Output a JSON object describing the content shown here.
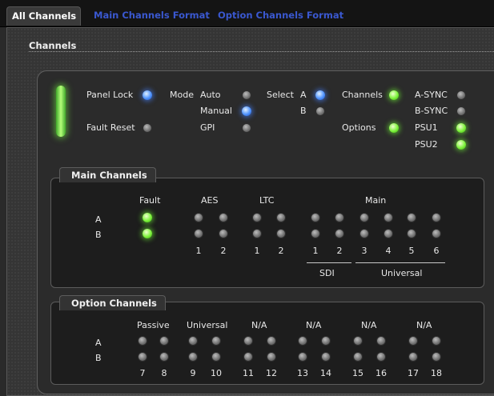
{
  "tabs": {
    "all_channels": "All Channels",
    "main_channels_format": "Main Channels Format",
    "option_channels_format": "Option Channels Format"
  },
  "section_title": "Channels",
  "status": {
    "panel_lock": "Panel Lock",
    "fault_reset": "Fault Reset",
    "mode": "Mode",
    "mode_auto": "Auto",
    "mode_manual": "Manual",
    "mode_gpi": "GPI",
    "select": "Select",
    "select_a": "A",
    "select_b": "B",
    "channels": "Channels",
    "options": "Options",
    "a_sync": "A-SYNC",
    "b_sync": "B-SYNC",
    "psu1": "PSU1",
    "psu2": "PSU2"
  },
  "main_channels": {
    "title": "Main Channels",
    "row_a": "A",
    "row_b": "B",
    "fault": "Fault",
    "aes": "AES",
    "ltc": "LTC",
    "main": "Main",
    "aes_nums": [
      "1",
      "2"
    ],
    "ltc_nums": [
      "1",
      "2"
    ],
    "main_nums": [
      "1",
      "2",
      "3",
      "4",
      "5",
      "6"
    ],
    "sdi": "SDI",
    "universal": "Universal"
  },
  "option_channels": {
    "title": "Option Channels",
    "row_a": "A",
    "row_b": "B",
    "headers": [
      "Passive",
      "Universal",
      "N/A",
      "N/A",
      "N/A",
      "N/A"
    ],
    "nums": [
      "7",
      "8",
      "9",
      "10",
      "11",
      "12",
      "13",
      "14",
      "15",
      "16",
      "17",
      "18"
    ]
  },
  "led_colors": {
    "off": "#7a7a7a",
    "blue": "#4f93ff",
    "green": "#7cf23a"
  }
}
